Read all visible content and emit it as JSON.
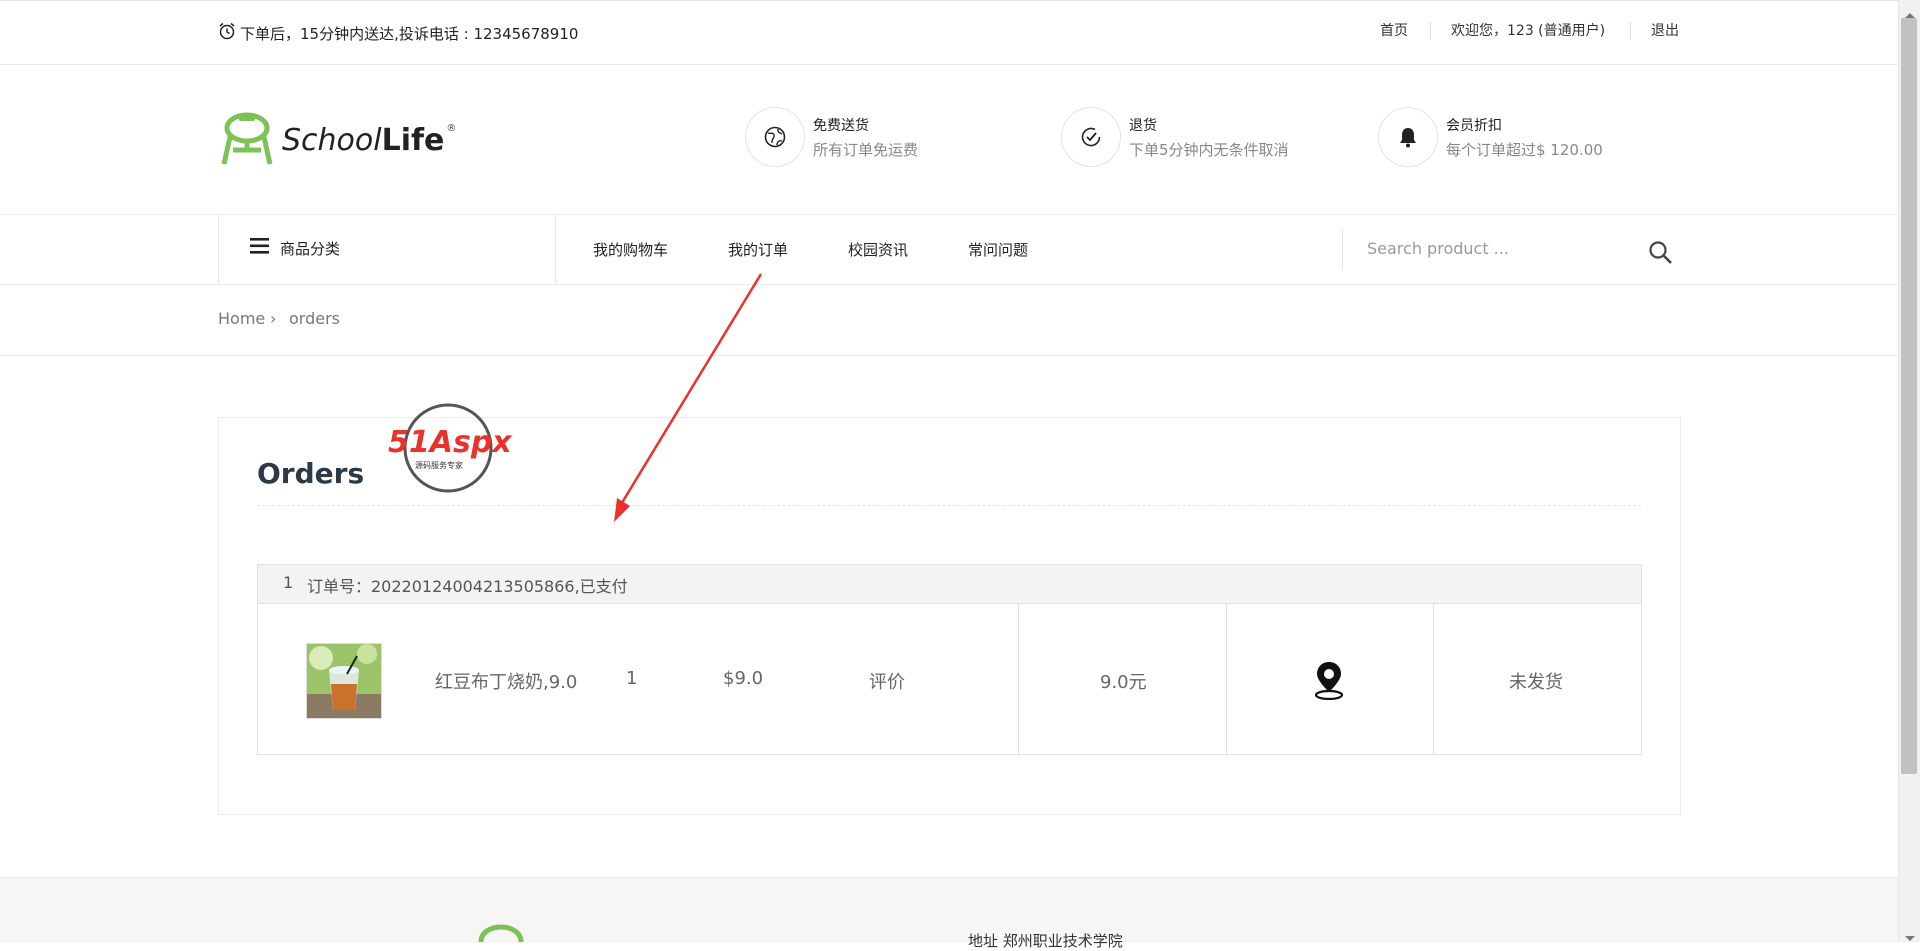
{
  "topbar": {
    "notice": "下单后，15分钟内送达,投诉电话 : 12345678910",
    "home": "首页",
    "welcome": "欢迎您，123 (普通用户)",
    "logout": "退出"
  },
  "logo": {
    "part1": "School",
    "part2": "Life",
    "reg": "®"
  },
  "features": [
    {
      "icon": "globe-icon",
      "title": "免费送货",
      "desc": "所有订单免运费"
    },
    {
      "icon": "check-circle-icon",
      "title": "退货",
      "desc": "下单5分钟内无条件取消"
    },
    {
      "icon": "bell-icon",
      "title": "会员折扣",
      "desc": "每个订单超过$ 120.00"
    }
  ],
  "nav": {
    "category": "商品分类",
    "links": [
      "我的购物车",
      "我的订单",
      "校园资讯",
      "常问问题"
    ],
    "search_placeholder": "Search product ..."
  },
  "breadcrumb": {
    "home": "Home",
    "sep": "›",
    "current": "orders"
  },
  "orders": {
    "title": "Orders",
    "watermark": {
      "brand": "51Aspx",
      "tagline": "源码服务专家"
    },
    "list": [
      {
        "index": "1",
        "header": "订单号：20220124004213505866,已支付",
        "item_name": "红豆布丁烧奶,9.0",
        "qty": "1",
        "price": "$9.0",
        "review": "评价",
        "total": "9.0元",
        "status": "未发货"
      }
    ]
  },
  "footer": {
    "address": "地址 郑州职业技术学院"
  },
  "colors": {
    "logo_green": "#7cc254",
    "arrow_red": "#e8322b",
    "title": "#2c3a47"
  }
}
